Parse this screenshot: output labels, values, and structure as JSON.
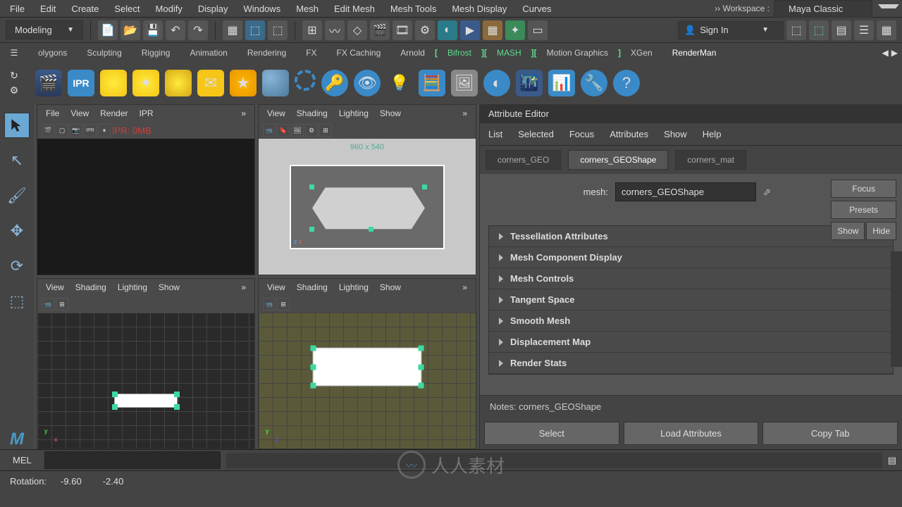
{
  "menubar": {
    "items": [
      "File",
      "Edit",
      "Create",
      "Select",
      "Modify",
      "Display",
      "Windows",
      "Mesh",
      "Edit Mesh",
      "Mesh Tools",
      "Mesh Display",
      "Curves"
    ],
    "workspace_label": "›› Workspace :",
    "workspace_value": "Maya Classic"
  },
  "toolbar2": {
    "mode": "Modeling",
    "signin": "Sign In"
  },
  "shelf_tabs": [
    "olygons",
    "Sculpting",
    "Rigging",
    "Animation",
    "Rendering",
    "FX",
    "FX Caching",
    "Arnold",
    "Bifrost",
    "MASH",
    "Motion Graphics",
    "XGen",
    "RenderMan"
  ],
  "vp": {
    "renderPanel": [
      "File",
      "View",
      "Render",
      "IPR"
    ],
    "panelMenu": [
      "View",
      "Shading",
      "Lighting",
      "Show"
    ],
    "resolution": "960 x 540",
    "iprLabel": "IPR: 0MB"
  },
  "attrEditor": {
    "title": "Attribute Editor",
    "menu": [
      "List",
      "Selected",
      "Focus",
      "Attributes",
      "Show",
      "Help"
    ],
    "tabs": [
      "corners_GEO",
      "corners_GEOShape",
      "corners_mat"
    ],
    "meshLabel": "mesh:",
    "meshValue": "corners_GEOShape",
    "buttons": {
      "focus": "Focus",
      "presets": "Presets",
      "show": "Show",
      "hide": "Hide"
    },
    "sections": [
      "Tessellation Attributes",
      "Mesh Component Display",
      "Mesh Controls",
      "Tangent Space",
      "Smooth Mesh",
      "Displacement Map",
      "Render Stats"
    ],
    "notesLabel": "Notes: corners_GEOShape",
    "bottomButtons": [
      "Select",
      "Load Attributes",
      "Copy Tab"
    ]
  },
  "cmd": {
    "mel": "MEL"
  },
  "status": {
    "label": "Rotation:",
    "x": "-9.60",
    "y": "-2.40"
  },
  "watermark": "人人素材"
}
